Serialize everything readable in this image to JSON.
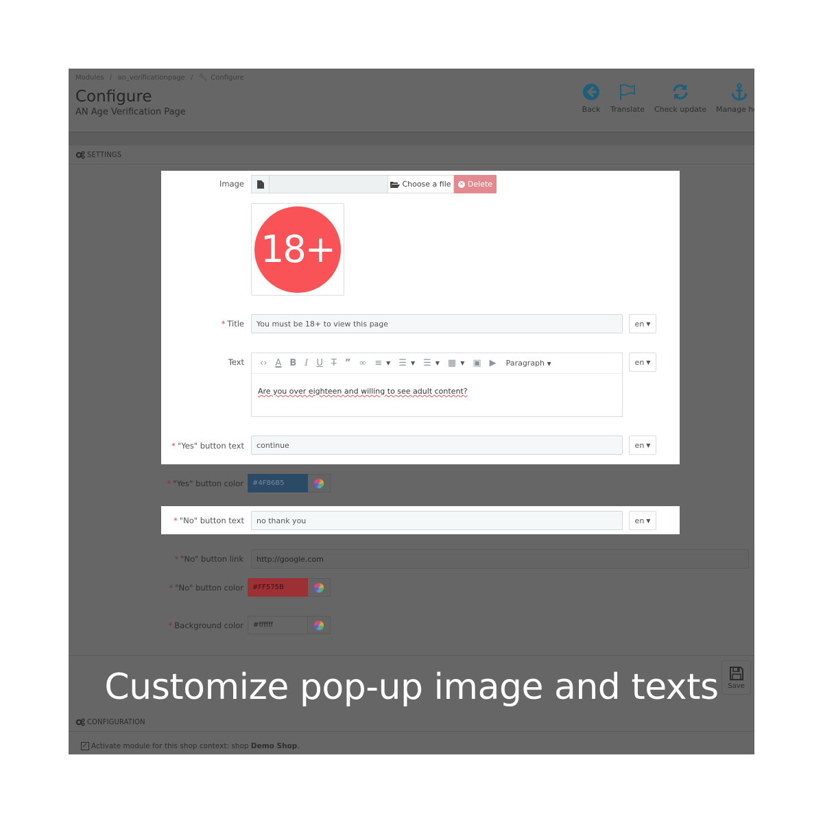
{
  "breadcrumb": [
    "Modules",
    "/",
    "an_verificationpage",
    "/",
    "Configure"
  ],
  "header": {
    "title": "Configure",
    "subtitle": "AN Age Verification Page"
  },
  "toolbar": {
    "back": "Back",
    "translate": "Translate",
    "check_update": "Check update",
    "manage_hooks": "Manage hoo"
  },
  "settings_panel": {
    "heading": "SETTINGS",
    "image": {
      "label": "Image",
      "choose_label": "Choose a file",
      "delete_label": "Delete",
      "preview_text": "18+"
    },
    "title": {
      "label": "Title",
      "value": "You must be 18+ to view this page",
      "lang": "en"
    },
    "text": {
      "label": "Text",
      "format": "Paragraph",
      "value": "Are you over eighteen and willing to see adult content?",
      "lang": "en"
    },
    "yes_text": {
      "label": "\"Yes\" button text",
      "value": "continue",
      "lang": "en"
    },
    "yes_color": {
      "label": "\"Yes\" button color",
      "value": "#4F86B5"
    },
    "no_text": {
      "label": "\"No\" button text",
      "value": "no thank you",
      "lang": "en"
    },
    "no_link": {
      "label": "\"No\" button link",
      "value": "http://google.com"
    },
    "no_color": {
      "label": "\"No\" button color",
      "value": "#FF575B"
    },
    "bg_color": {
      "label": "Background color",
      "value": "#ffffff"
    },
    "save_label": "Save"
  },
  "config_panel": {
    "heading": "CONFIGURATION",
    "activate_text": "Activate module for this shop context: shop",
    "shop_name": "Demo Shop",
    "activate_suffix": ".",
    "activated": true
  },
  "caption": "Customize pop-up image and texts",
  "colors": {
    "accent": "#1d5f7a",
    "required": "#e04848",
    "delete": "#e28a90",
    "badge": "#f95358",
    "yes_swatch_dimmed": "#2b4a66",
    "no_swatch_dimmed": "#9c3034"
  }
}
